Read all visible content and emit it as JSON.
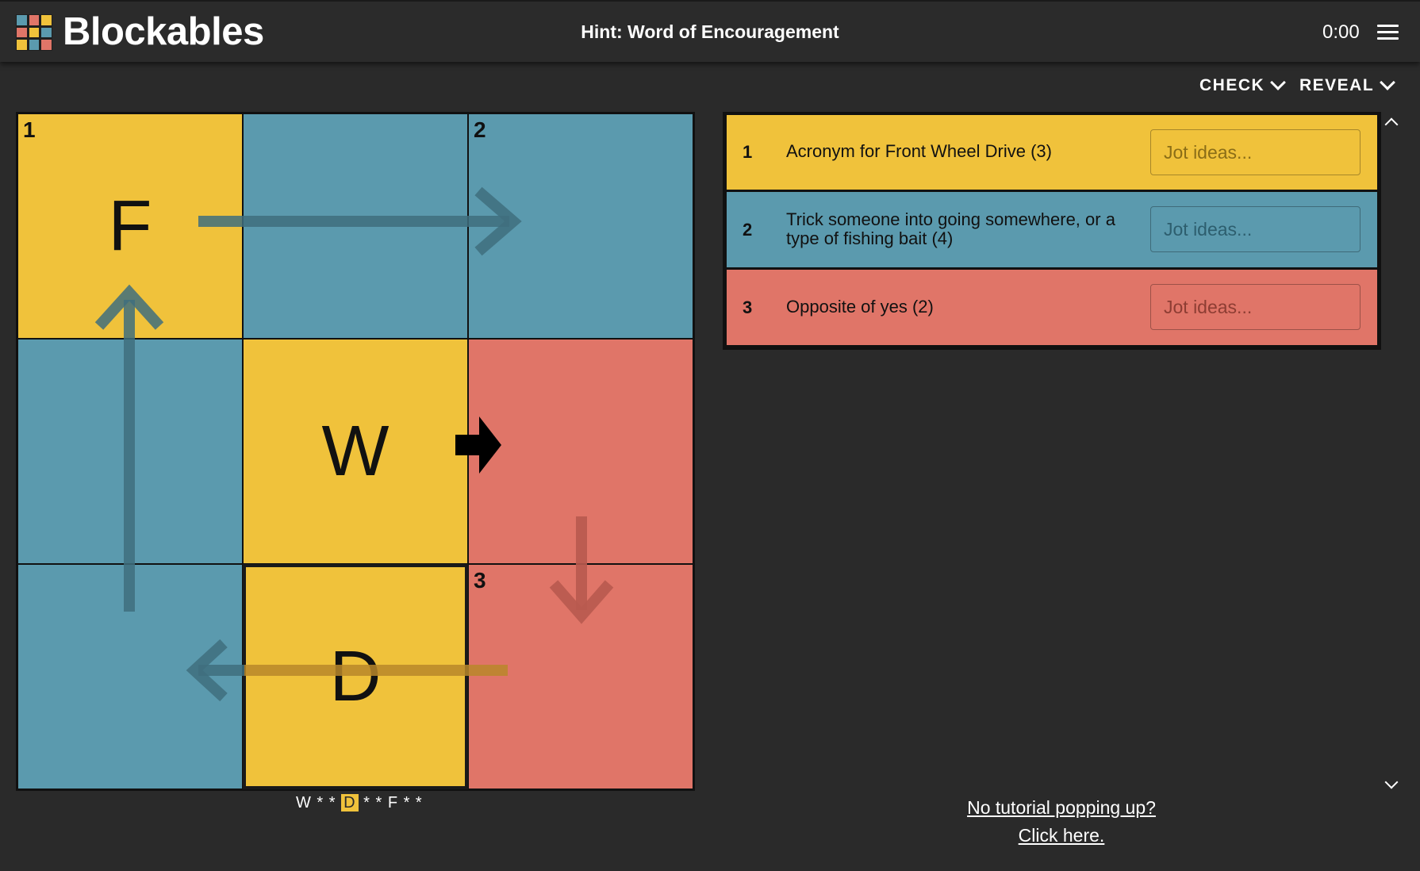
{
  "header": {
    "brand": "Blockables",
    "hint": "Hint: Word of Encouragement",
    "timer": "0:00",
    "logo_colors": [
      "#5b9aae",
      "#e07568",
      "#f0c23b",
      "#e07568",
      "#f0c23b",
      "#5b9aae",
      "#f0c23b",
      "#5b9aae",
      "#e07568"
    ]
  },
  "toolbar": {
    "check_label": "CHECK",
    "reveal_label": "REVEAL"
  },
  "colors": {
    "yellow": "#f0c23b",
    "blue": "#5b9aae",
    "red": "#e07568",
    "background": "#2a2a2a"
  },
  "board": {
    "rows": 3,
    "cols": 3,
    "cells": [
      {
        "row": 0,
        "col": 0,
        "color": "yellow",
        "number": "1",
        "letter": "F"
      },
      {
        "row": 0,
        "col": 1,
        "color": "blue",
        "number": "",
        "letter": ""
      },
      {
        "row": 0,
        "col": 2,
        "color": "blue",
        "number": "2",
        "letter": ""
      },
      {
        "row": 1,
        "col": 0,
        "color": "blue",
        "number": "",
        "letter": ""
      },
      {
        "row": 1,
        "col": 1,
        "color": "yellow",
        "number": "",
        "letter": "W"
      },
      {
        "row": 1,
        "col": 2,
        "color": "red",
        "number": "",
        "letter": ""
      },
      {
        "row": 2,
        "col": 0,
        "color": "blue",
        "number": "",
        "letter": ""
      },
      {
        "row": 2,
        "col": 1,
        "color": "yellow",
        "number": "",
        "letter": "D",
        "selected": true
      },
      {
        "row": 2,
        "col": 2,
        "color": "red",
        "number": "3",
        "letter": ""
      }
    ]
  },
  "progress": {
    "before": "W * * ",
    "current": "D",
    "after": " * * F * *"
  },
  "clues": [
    {
      "number": "1",
      "text": "Acronym for Front Wheel Drive (3)",
      "color": "yellow",
      "placeholder": "Jot ideas..."
    },
    {
      "number": "2",
      "text": "Trick someone into going somewhere, or a type of fishing bait (4)",
      "color": "blue",
      "placeholder": "Jot ideas..."
    },
    {
      "number": "3",
      "text": "Opposite of yes (2)",
      "color": "red",
      "placeholder": "Jot ideas..."
    }
  ],
  "tutorial": {
    "line1": "No tutorial popping up?",
    "line2": "Click here."
  }
}
